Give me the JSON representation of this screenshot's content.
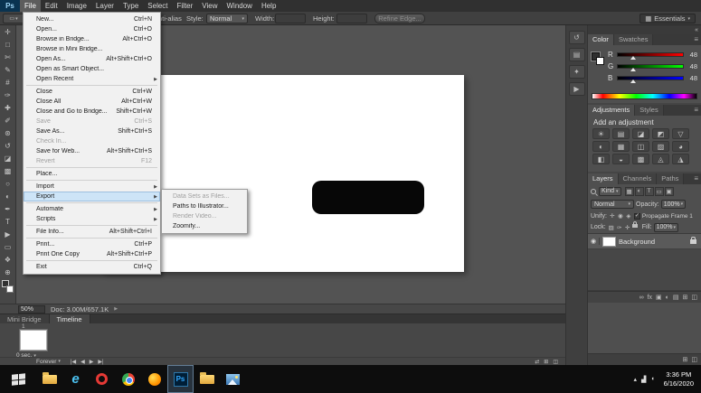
{
  "icons": {
    "chevron_down": "▾",
    "submenu_arrow": "▶",
    "double_arrow": "«",
    "eye": "◉",
    "check": "✓",
    "panel_menu": "≡",
    "workspace_grid": "▦",
    "tool_preset": "▭"
  },
  "menubar": {
    "logo": "Ps",
    "items": [
      {
        "label": "File",
        "active": true
      },
      {
        "label": "Edit"
      },
      {
        "label": "Image"
      },
      {
        "label": "Layer"
      },
      {
        "label": "Type"
      },
      {
        "label": "Select"
      },
      {
        "label": "Filter"
      },
      {
        "label": "View"
      },
      {
        "label": "Window"
      },
      {
        "label": "Help"
      }
    ]
  },
  "options": {
    "anti_alias": "Anti-alias",
    "style_label": "Style:",
    "style_value": "Normal",
    "width_label": "Width:",
    "width_value": "",
    "height_label": "Height:",
    "height_value": "",
    "refine_edge": "Refine Edge...",
    "workspace": "Essentials"
  },
  "file_menu": {
    "items": [
      {
        "type": "item",
        "label": "New...",
        "shortcut": "Ctrl+N"
      },
      {
        "type": "item",
        "label": "Open...",
        "shortcut": "Ctrl+O"
      },
      {
        "type": "item",
        "label": "Browse in Bridge...",
        "shortcut": "Alt+Ctrl+O"
      },
      {
        "type": "item",
        "label": "Browse in Mini Bridge..."
      },
      {
        "type": "item",
        "label": "Open As...",
        "shortcut": "Alt+Shift+Ctrl+O"
      },
      {
        "type": "item",
        "label": "Open as Smart Object..."
      },
      {
        "type": "item",
        "label": "Open Recent",
        "submenu": true
      },
      {
        "type": "separator"
      },
      {
        "type": "item",
        "label": "Close",
        "shortcut": "Ctrl+W"
      },
      {
        "type": "item",
        "label": "Close All",
        "shortcut": "Alt+Ctrl+W"
      },
      {
        "type": "item",
        "label": "Close and Go to Bridge...",
        "shortcut": "Shift+Ctrl+W"
      },
      {
        "type": "item",
        "label": "Save",
        "shortcut": "Ctrl+S",
        "disabled": true
      },
      {
        "type": "item",
        "label": "Save As...",
        "shortcut": "Shift+Ctrl+S"
      },
      {
        "type": "item",
        "label": "Check In...",
        "disabled": true
      },
      {
        "type": "item",
        "label": "Save for Web...",
        "shortcut": "Alt+Shift+Ctrl+S"
      },
      {
        "type": "item",
        "label": "Revert",
        "shortcut": "F12",
        "disabled": true
      },
      {
        "type": "separator"
      },
      {
        "type": "item",
        "label": "Place..."
      },
      {
        "type": "separator"
      },
      {
        "type": "item",
        "label": "Import",
        "submenu": true
      },
      {
        "type": "item",
        "label": "Export",
        "submenu": true,
        "highlight": true
      },
      {
        "type": "separator"
      },
      {
        "type": "item",
        "label": "Automate",
        "submenu": true
      },
      {
        "type": "item",
        "label": "Scripts",
        "submenu": true
      },
      {
        "type": "separator"
      },
      {
        "type": "item",
        "label": "File Info...",
        "shortcut": "Alt+Shift+Ctrl+I"
      },
      {
        "type": "separator"
      },
      {
        "type": "item",
        "label": "Print...",
        "shortcut": "Ctrl+P"
      },
      {
        "type": "item",
        "label": "Print One Copy",
        "shortcut": "Alt+Shift+Ctrl+P"
      },
      {
        "type": "separator"
      },
      {
        "type": "item",
        "label": "Exit",
        "shortcut": "Ctrl+Q"
      }
    ]
  },
  "export_submenu": {
    "items": [
      {
        "label": "Data Sets as Files...",
        "disabled": true
      },
      {
        "label": "Paths to Illustrator..."
      },
      {
        "label": "Render Video...",
        "disabled": true
      },
      {
        "label": "Zoomify..."
      }
    ]
  },
  "tools": [
    {
      "name": "move-tool",
      "glyph": "✛"
    },
    {
      "name": "marquee-tool",
      "glyph": "□"
    },
    {
      "name": "lasso-tool",
      "glyph": "✄"
    },
    {
      "name": "quick-selection-tool",
      "glyph": "✎"
    },
    {
      "name": "crop-tool",
      "glyph": "#"
    },
    {
      "name": "eyedropper-tool",
      "glyph": "✑"
    },
    {
      "name": "healing-brush-tool",
      "glyph": "✚"
    },
    {
      "name": "brush-tool",
      "glyph": "✐"
    },
    {
      "name": "clone-stamp-tool",
      "glyph": "⊛"
    },
    {
      "name": "history-brush-tool",
      "glyph": "↺"
    },
    {
      "name": "eraser-tool",
      "glyph": "◪"
    },
    {
      "name": "gradient-tool",
      "glyph": "▩"
    },
    {
      "name": "blur-tool",
      "glyph": "○"
    },
    {
      "name": "dodge-tool",
      "glyph": "◐"
    },
    {
      "name": "pen-tool",
      "glyph": "✒"
    },
    {
      "name": "type-tool",
      "glyph": "T"
    },
    {
      "name": "path-selection-tool",
      "glyph": "▶"
    },
    {
      "name": "shape-tool",
      "glyph": "▭"
    },
    {
      "name": "hand-tool",
      "glyph": "❖"
    },
    {
      "name": "zoom-tool",
      "glyph": "⊕"
    }
  ],
  "dock_icons": [
    {
      "name": "history-panel-icon",
      "glyph": "↺"
    },
    {
      "name": "properties-panel-icon",
      "glyph": "▤"
    },
    {
      "name": "info-panel-icon",
      "glyph": "✦"
    },
    {
      "name": "actions-panel-icon",
      "glyph": "▶"
    }
  ],
  "color_panel": {
    "tabs": [
      "Color",
      "Swatches"
    ],
    "sliders": [
      {
        "label": "R",
        "value": "48"
      },
      {
        "label": "G",
        "value": "48"
      },
      {
        "label": "B",
        "value": "48"
      }
    ]
  },
  "adjustments_panel": {
    "tabs": [
      "Adjustments",
      "Styles"
    ],
    "heading": "Add an adjustment",
    "icons": [
      {
        "name": "brightness-contrast",
        "glyph": "☀"
      },
      {
        "name": "levels",
        "glyph": "▤"
      },
      {
        "name": "curves",
        "glyph": "◪"
      },
      {
        "name": "exposure",
        "glyph": "◩"
      },
      {
        "name": "vibrance",
        "glyph": "▽"
      },
      {
        "name": "hue-saturation",
        "glyph": "◐"
      },
      {
        "name": "color-balance",
        "glyph": "▦"
      },
      {
        "name": "black-white",
        "glyph": "◫"
      },
      {
        "name": "photo-filter",
        "glyph": "▨"
      },
      {
        "name": "channel-mixer",
        "glyph": "◕"
      },
      {
        "name": "color-lookup",
        "glyph": "◧"
      },
      {
        "name": "invert",
        "glyph": "◒"
      },
      {
        "name": "posterize",
        "glyph": "▩"
      },
      {
        "name": "threshold",
        "glyph": "◬"
      },
      {
        "name": "gradient-map",
        "glyph": "◮"
      }
    ]
  },
  "layers_panel": {
    "tabs": [
      "Layers",
      "Channels",
      "Paths"
    ],
    "kind_label": "Kind",
    "filter_icons": [
      {
        "name": "filter-pixel-layers",
        "glyph": "▦"
      },
      {
        "name": "filter-adjustment-layers",
        "glyph": "◐"
      },
      {
        "name": "filter-type-layers",
        "glyph": "T"
      },
      {
        "name": "filter-shape-layers",
        "glyph": "▭"
      },
      {
        "name": "filter-smart-objects",
        "glyph": "▣"
      }
    ],
    "blend_mode": "Normal",
    "opacity_label": "Opacity:",
    "opacity_value": "100%",
    "unify_label": "Unify:",
    "unify_icons": [
      {
        "name": "unify-position",
        "glyph": "✛"
      },
      {
        "name": "unify-visibility",
        "glyph": "◉"
      },
      {
        "name": "unify-style",
        "glyph": "◈"
      }
    ],
    "propagate_label": "Propagate Frame 1",
    "lock_label": "Lock:",
    "lock_icons": [
      {
        "name": "lock-transparency",
        "glyph": "▨"
      },
      {
        "name": "lock-image",
        "glyph": "✑"
      },
      {
        "name": "lock-position",
        "glyph": "✛"
      },
      {
        "name": "lock-all",
        "css": "lock"
      }
    ],
    "fill_label": "Fill:",
    "fill_value": "100%",
    "layers": [
      {
        "name": "Background",
        "locked": true,
        "visible": true
      }
    ],
    "bottom_icons": [
      {
        "name": "link-layers",
        "glyph": "∞"
      },
      {
        "name": "layer-effects",
        "glyph": "fx"
      },
      {
        "name": "add-layer-mask",
        "glyph": "▣"
      },
      {
        "name": "new-adjustment-layer",
        "glyph": "◐"
      },
      {
        "name": "new-group",
        "glyph": "▤"
      },
      {
        "name": "new-layer",
        "glyph": "⊞"
      },
      {
        "name": "delete-layer",
        "glyph": "◫"
      }
    ],
    "dock_bottom_icons": [
      {
        "name": "new-item",
        "glyph": "⊞"
      },
      {
        "name": "delete-item",
        "glyph": "◫"
      }
    ]
  },
  "status_bar": {
    "zoom": "50%",
    "doc": "Doc: 3.00M/657.1K"
  },
  "timeline": {
    "tabs": [
      "Mini Bridge",
      "Timeline"
    ],
    "frame_number": "1",
    "frame_delay": "0 sec.",
    "loop": "Forever",
    "transport": [
      {
        "name": "first-frame",
        "glyph": "|◀"
      },
      {
        "name": "previous-frame",
        "glyph": "◀"
      },
      {
        "name": "play",
        "glyph": "▶"
      },
      {
        "name": "next-frame",
        "glyph": "▶|"
      }
    ],
    "right_buttons": [
      {
        "name": "tween",
        "glyph": "⇄"
      },
      {
        "name": "duplicate-frame",
        "glyph": "⊞"
      },
      {
        "name": "delete-frame",
        "glyph": "◫"
      }
    ]
  },
  "taskbar": {
    "time": "3:36 PM",
    "date": "6/16/2020",
    "apps": [
      {
        "name": "file-explorer",
        "type": "folder"
      },
      {
        "name": "internet-explorer",
        "type": "ie",
        "glyph": "e"
      },
      {
        "name": "opera",
        "type": "opera"
      },
      {
        "name": "chrome",
        "type": "chrome"
      },
      {
        "name": "firefox",
        "type": "firefox"
      },
      {
        "name": "photoshop",
        "type": "ps",
        "glyph": "Ps",
        "active": true
      },
      {
        "name": "folder",
        "type": "folder"
      },
      {
        "name": "pictures",
        "type": "pictures"
      }
    ],
    "tray": [
      {
        "name": "show-hidden-icons",
        "glyph": "▴"
      },
      {
        "name": "network",
        "glyph": "▟"
      },
      {
        "name": "volume",
        "glyph": "◖"
      }
    ]
  }
}
